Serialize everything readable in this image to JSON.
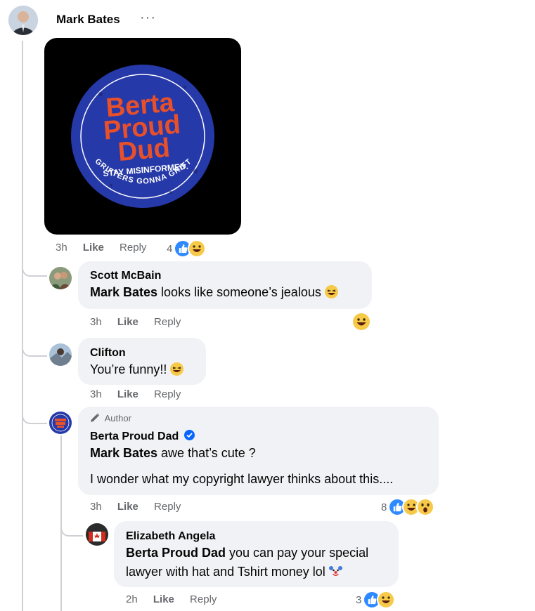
{
  "post": {
    "author": "Mark Bates",
    "more": "···",
    "image_text": {
      "line1": "Berta",
      "line2": "Proud",
      "line3": "Dud",
      "tagline": "STAY MISINFORMED.",
      "arc": "GRIFTERS GONNA GRIFT"
    },
    "time": "3h",
    "like": "Like",
    "reply": "Reply",
    "reaction_count": "4"
  },
  "comments": [
    {
      "author": "Scott McBain",
      "mention": "Mark Bates",
      "text": " looks like someone’s jealous ",
      "time": "3h",
      "like": "Like",
      "reply": "Reply"
    },
    {
      "author": "Clifton",
      "text": "You’re funny!! ",
      "time": "3h",
      "like": "Like",
      "reply": "Reply"
    },
    {
      "badge": "Author",
      "author": "Berta Proud Dad",
      "mention": "Mark Bates",
      "text1": " awe that’s cute ?",
      "text2": "I wonder what my copyright lawyer thinks about this....",
      "time": "3h",
      "like": "Like",
      "reply": "Reply",
      "reaction_count": "8"
    },
    {
      "author": "Elizabeth Angela",
      "mention": "Berta Proud Dad",
      "text1": " you can pay your special",
      "text2": "lawyer with hat and Tshirt money lol ",
      "time": "2h",
      "like": "Like",
      "reply": "Reply",
      "reaction_count": "3"
    }
  ],
  "colors": {
    "bubble": "#f0f2f5",
    "secondary_text": "#65676b",
    "like_blue": "#2e89ff",
    "verified": "#0866ff",
    "sticker_blue": "#2639a8",
    "sticker_orange": "#e8502a"
  }
}
